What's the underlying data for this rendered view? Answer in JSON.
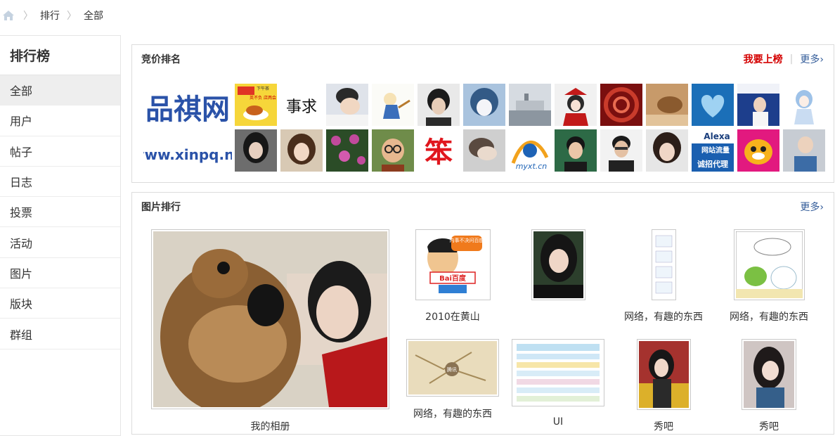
{
  "breadcrumb": {
    "items": [
      "排行",
      "全部"
    ]
  },
  "sidebar": {
    "title": "排行榜",
    "items": [
      {
        "label": "全部",
        "active": true
      },
      {
        "label": "用户"
      },
      {
        "label": "帖子"
      },
      {
        "label": "日志"
      },
      {
        "label": "投票"
      },
      {
        "label": "活动"
      },
      {
        "label": "图片"
      },
      {
        "label": "版块"
      },
      {
        "label": "群组"
      }
    ]
  },
  "bidding": {
    "title": "竞价排名",
    "promote_label": "我要上榜",
    "more_label": "更多›",
    "logo": {
      "line1": "品祺网",
      "line2": "www.xinpq.ne"
    },
    "thumb_texts": {
      "tea_top": "下午茶",
      "tea_mid": "英不负 店两会",
      "calligraphy": "事求",
      "ben": "笨",
      "sitemark": "myxt.cn",
      "alexa": "Alexa",
      "traffic": "网站流量",
      "agent": "诚招代理"
    }
  },
  "photos": {
    "title": "图片排行",
    "more_label": "更多›",
    "items": [
      {
        "caption": "我的相册"
      },
      {
        "caption": "2010在黄山",
        "bubble": "内事不决问百度",
        "badge": "Bai百度"
      },
      {
        "caption": ""
      },
      {
        "caption": "网络，有趣的东西"
      },
      {
        "caption": "网络，有趣的东西"
      },
      {
        "caption": "网络，有趣的东西",
        "map_label": "腾讯"
      },
      {
        "caption": "UI"
      },
      {
        "caption": "秀吧"
      },
      {
        "caption": "秀吧"
      }
    ]
  },
  "colors": {
    "accent_red": "#d40000",
    "link_blue": "#335c99",
    "border": "#dcdcdc"
  }
}
